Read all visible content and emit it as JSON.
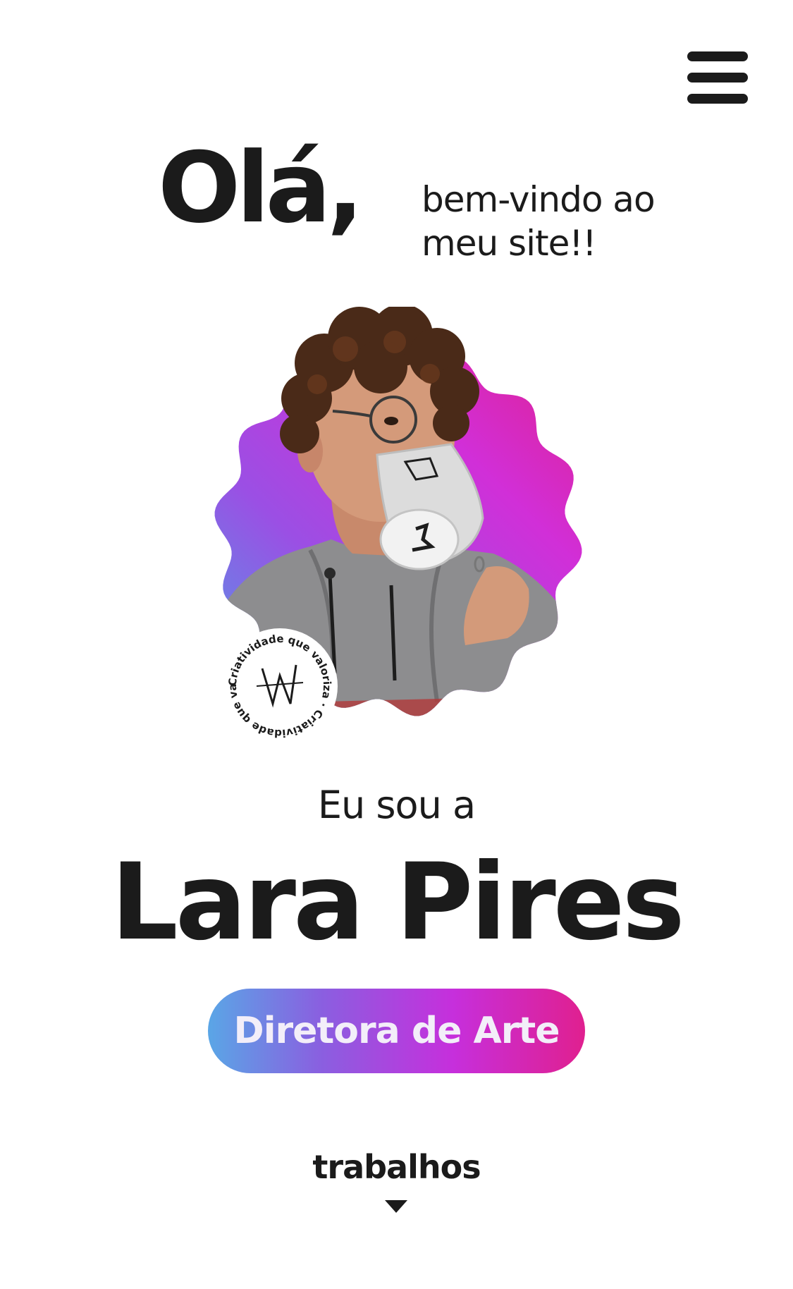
{
  "header": {
    "menu_icon": "hamburger-menu-icon"
  },
  "greeting": {
    "title": "Olá,",
    "subtitle_line1": "bem-vindo ao",
    "subtitle_line2": "meu site!!"
  },
  "portrait": {
    "stamp_text": "Criatividade que valoriza · Criatividade que valoriza ·",
    "gradient_colors": [
      "#4f9fe6",
      "#9b4fe4",
      "#d12fd8",
      "#e0208f"
    ]
  },
  "intro": {
    "line": "Eu sou a",
    "name": "Lara Pires"
  },
  "role": {
    "label": "Diretora de Arte"
  },
  "works": {
    "label": "trabalhos",
    "icon": "caret-down-icon"
  },
  "colors": {
    "text": "#1b1b1b",
    "background": "#ffffff"
  }
}
